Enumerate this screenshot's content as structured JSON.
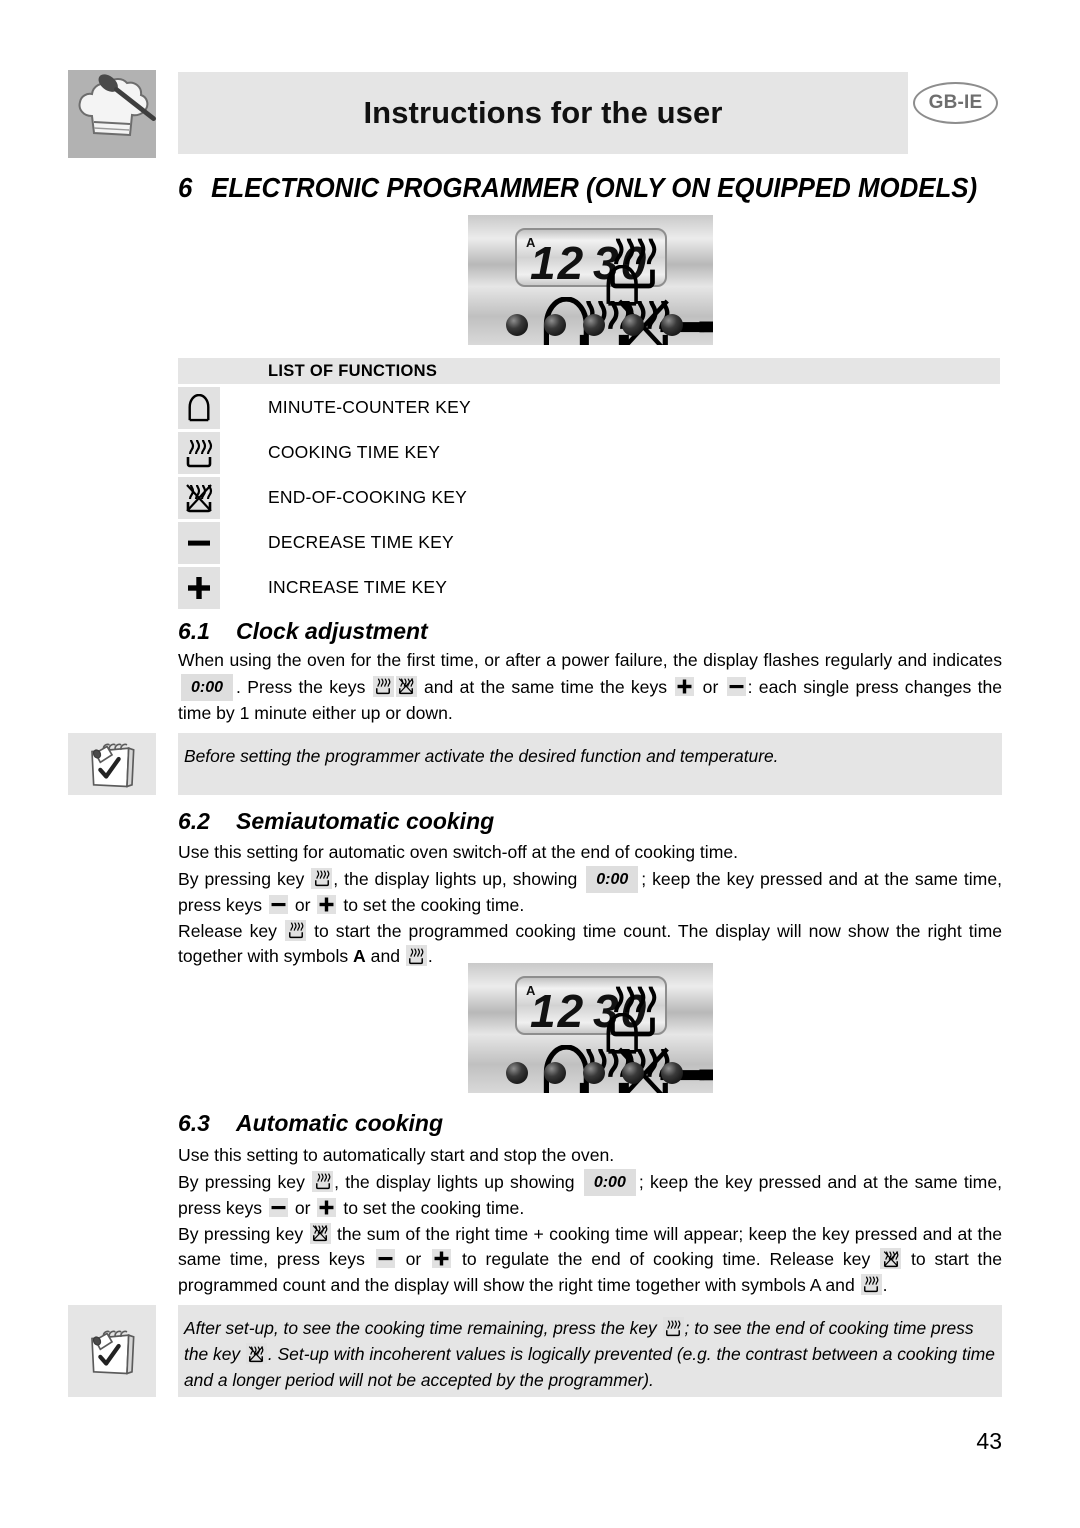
{
  "header": {
    "title": "Instructions for the user",
    "language_badge": "GB-IE",
    "chef_icon": "chef-hat-spoon-icon"
  },
  "chapter": {
    "number": "6",
    "title": "ELECTRONIC PROGRAMMER (ONLY ON EQUIPPED MODELS)"
  },
  "programmer_display": {
    "annunciator": "A",
    "time": "12:30",
    "hours": "12",
    "minutes": "30",
    "indicator_cooking": "cooking-time-icon",
    "indicator_bell": "minute-counter-icon",
    "buttons": [
      {
        "icon": "minute-counter-icon",
        "name": "minute-counter-key"
      },
      {
        "icon": "cooking-time-icon",
        "name": "cooking-time-key"
      },
      {
        "icon": "end-of-cooking-icon",
        "name": "end-of-cooking-key"
      },
      {
        "icon": "minus-icon",
        "name": "decrease-time-key"
      },
      {
        "icon": "plus-icon",
        "name": "increase-time-key"
      }
    ]
  },
  "functions": {
    "heading": "LIST OF FUNCTIONS",
    "items": [
      {
        "icon": "minute-counter-icon",
        "label": "MINUTE-COUNTER KEY"
      },
      {
        "icon": "cooking-time-icon",
        "label": "COOKING TIME KEY"
      },
      {
        "icon": "end-of-cooking-icon",
        "label": "END-OF-COOKING KEY"
      },
      {
        "icon": "minus-icon",
        "label": "DECREASE TIME KEY"
      },
      {
        "icon": "plus-icon",
        "label": "INCREASE TIME KEY"
      }
    ]
  },
  "sections": {
    "clock": {
      "number": "6.1",
      "title": "Clock adjustment",
      "p1_a": "When using the oven for the first time, or after a power failure, the display flashes regularly and indicates",
      "lcd": "0:00",
      "p1_b": ". Press the keys",
      "p1_c": "and at the same time the keys",
      "p1_or": "or",
      "p1_d": ": each single press changes the time by 1 minute either up or down."
    },
    "note1": {
      "text": "Before setting the programmer activate the desired function and temperature.",
      "icon": "notepad-pencil-icon"
    },
    "semiautomatic": {
      "number": "6.2",
      "title": "Semiautomatic cooking",
      "p1": "Use this setting for automatic oven switch-off at the end of cooking time.",
      "p2_a": "By pressing key",
      "p2_b": ", the display lights up, showing",
      "lcd": "0:00",
      "p2_c": "; keep the key pressed and at the same time, press keys",
      "p2_or": "or",
      "p2_d": "to set the cooking time.",
      "p3_a": "Release key",
      "p3_b": "to start the programmed cooking time count. The display will now show the right time together with symbols",
      "p3_sym": "A",
      "p3_and": "and",
      "p3_end": "."
    },
    "automatic": {
      "number": "6.3",
      "title": "Automatic cooking",
      "p1": "Use this setting to automatically start and stop the oven.",
      "p2_a": "By pressing key",
      "p2_b": ", the display lights up showing",
      "lcd": "0:00",
      "p2_c": "; keep the key pressed and at the same time, press keys",
      "p2_or": "or",
      "p2_d": "to set the cooking time.",
      "p3_a": "By pressing key",
      "p3_b": "the sum of the right time + cooking time will appear; keep the key pressed and at the same time, press keys",
      "p3_or": "or",
      "p3_c": "to regulate the end of cooking time. Release key",
      "p3_d": "to start the programmed count and the display will show the right time together with symbols A and",
      "p3_end": "."
    },
    "note2": {
      "icon": "notepad-pencil-icon",
      "t_a": "After set-up, to see the cooking time remaining, press the key",
      "t_b": "; to see the end of cooking time press the key",
      "t_c": ". Set-up with incoherent values is logically prevented (e.g. the contrast between a cooking time and a longer period will not be accepted by the programmer)."
    }
  },
  "footer": {
    "page_number": "43"
  },
  "colors": {
    "band_gray": "#e5e5e5",
    "badge_gray": "#b2b2b2",
    "icon_bg": "#e1e1e1",
    "text": "#000000",
    "lang_badge_outline": "#8d8d8d"
  }
}
